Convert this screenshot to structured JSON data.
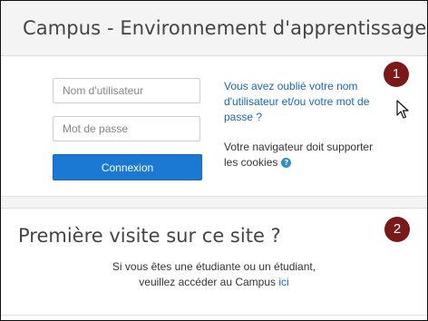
{
  "header": {
    "title": "Campus - Environnement d'apprentissage"
  },
  "login": {
    "username_placeholder": "Nom d'utilisateur",
    "password_placeholder": "Mot de passe",
    "button_label": "Connexion",
    "forgot_link": "Vous avez oublié votre nom d'utilisateur et/ou votre mot de passe ?",
    "cookies_text": "Votre navigateur doit supporter les cookies",
    "help_icon": "question-circle-icon",
    "help_glyph": "?"
  },
  "badges": [
    "1",
    "2"
  ],
  "first_visit": {
    "heading": "Première visite sur ce site ?",
    "line1": "Si vous êtes une étudiante ou un étudiant,",
    "line2_prefix": "veuillez accéder au Campus ",
    "link_label": "ici"
  },
  "colors": {
    "accent": "#1c79d3",
    "link": "#1668bd",
    "badge": "#7b1818",
    "header_bg": "#f4f4f4"
  },
  "icons": {
    "cursor": "mouse-pointer-icon"
  }
}
